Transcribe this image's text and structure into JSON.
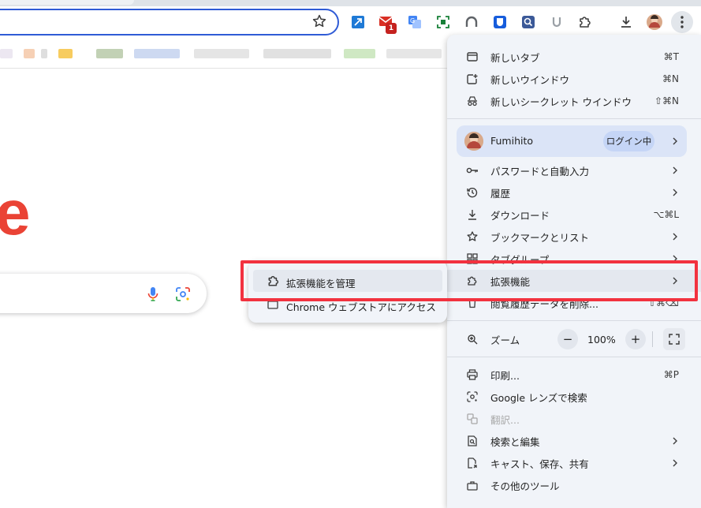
{
  "menu": {
    "items": [
      {
        "label": "新しいタブ",
        "shortcut": "⌘T",
        "icon": "new-tab-icon"
      },
      {
        "label": "新しいウインドウ",
        "shortcut": "⌘N",
        "icon": "new-window-icon"
      },
      {
        "label": "新しいシークレット ウインドウ",
        "shortcut": "⇧⌘N",
        "icon": "incognito-icon"
      }
    ],
    "profile": {
      "name": "Fumihito",
      "badge": "ログイン中"
    },
    "items2": [
      {
        "label": "パスワードと自動入力",
        "icon": "key-icon"
      },
      {
        "label": "履歴",
        "icon": "history-icon"
      },
      {
        "label": "ダウンロード",
        "shortcut": "⌥⌘L",
        "icon": "download-icon"
      },
      {
        "label": "ブックマークとリスト",
        "icon": "star-icon"
      },
      {
        "label": "タブグループ",
        "icon": "tab-groups-icon"
      },
      {
        "label": "拡張機能",
        "icon": "extensions-icon"
      },
      {
        "label": "閲覧履歴データを削除...",
        "shortcut": "⇧⌘⌫",
        "icon": "trash-icon"
      }
    ],
    "zoom": {
      "label": "ズーム",
      "value": "100%",
      "minus": "−",
      "plus": "+"
    },
    "items3": [
      {
        "label": "印刷...",
        "shortcut": "⌘P",
        "icon": "print-icon"
      },
      {
        "label": "Google レンズで検索",
        "icon": "lens-icon"
      },
      {
        "label": "翻訳...",
        "icon": "translate-icon",
        "disabled": true
      },
      {
        "label": "検索と編集",
        "icon": "find-icon"
      },
      {
        "label": "キャスト、保存、共有",
        "icon": "cast-icon"
      },
      {
        "label": "その他のツール",
        "icon": "tools-icon"
      }
    ]
  },
  "submenu": {
    "items": [
      {
        "label": "拡張機能を管理",
        "icon": "extensions-icon"
      },
      {
        "label": "Chrome ウェブストアにアクセス",
        "icon": "webstore-icon"
      }
    ]
  },
  "toolbar": {
    "mail_badge": "1"
  },
  "colors": {
    "accent": "#2f5bd6",
    "highlight": "#f2323f",
    "google_red": "#ea4335"
  },
  "page": {
    "logo_fragment": "e"
  }
}
